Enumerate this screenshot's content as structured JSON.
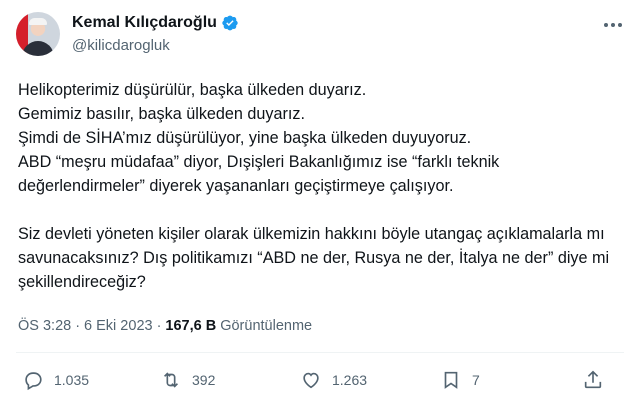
{
  "author": {
    "display_name": "Kemal Kılıçdaroğlu",
    "handle": "@kilicdarogluk",
    "verified_icon": "verified-badge-icon",
    "accent": "#1d9bf0"
  },
  "tweet": {
    "text": "Helikopterimiz düşürülür, başka ülkeden duyarız.\nGemimiz basılır, başka ülkeden duyarız.\nŞimdi de SİHA’mız düşürülüyor, yine başka ülkeden duyuyoruz.\nABD “meşru müdafaa” diyor, Dışişleri Bakanlığımız ise “farklı teknik değerlendirmeler” diyerek yaşananları geçiştirmeye çalışıyor.\n\nSiz devleti yöneten kişiler olarak ülkemizin hakkını böyle utangaç açıklamalarla mı savunacaksınız? Dış politikamızı “ABD ne der, Rusya ne der, İtalya ne der” diye mi şekillendireceğiz?",
    "time": "ÖS 3:28",
    "separator": "·",
    "date": "6 Eki 2023",
    "views_count": "167,6 B",
    "views_label": "Görüntülenme"
  },
  "actions": {
    "reply_count": "1.035",
    "retweet_count": "392",
    "like_count": "1.263",
    "bookmark_count": "7"
  }
}
